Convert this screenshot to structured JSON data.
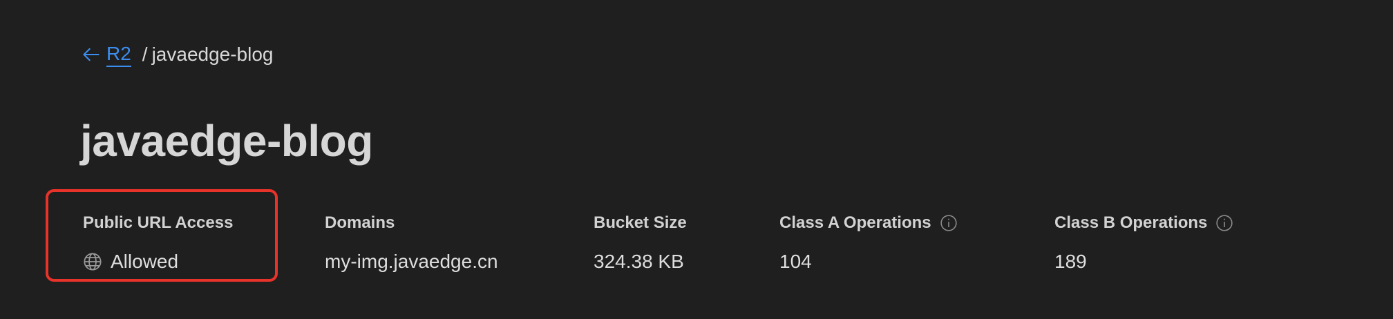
{
  "breadcrumb": {
    "back_label": "R2",
    "separator": "/",
    "current": "javaedge-blog"
  },
  "page": {
    "title": "javaedge-blog"
  },
  "stats": {
    "public_url_access": {
      "label": "Public URL Access",
      "value": "Allowed",
      "icon": "globe-icon"
    },
    "domains": {
      "label": "Domains",
      "value": "my-img.javaedge.cn"
    },
    "bucket_size": {
      "label": "Bucket Size",
      "value": "324.38 KB"
    },
    "class_a_operations": {
      "label": "Class A Operations",
      "value": "104",
      "icon": "info-icon"
    },
    "class_b_operations": {
      "label": "Class B Operations",
      "value": "189",
      "icon": "info-icon"
    }
  },
  "colors": {
    "background": "#1f1f1f",
    "link": "#3b8ef0",
    "highlight": "#e8332a"
  }
}
